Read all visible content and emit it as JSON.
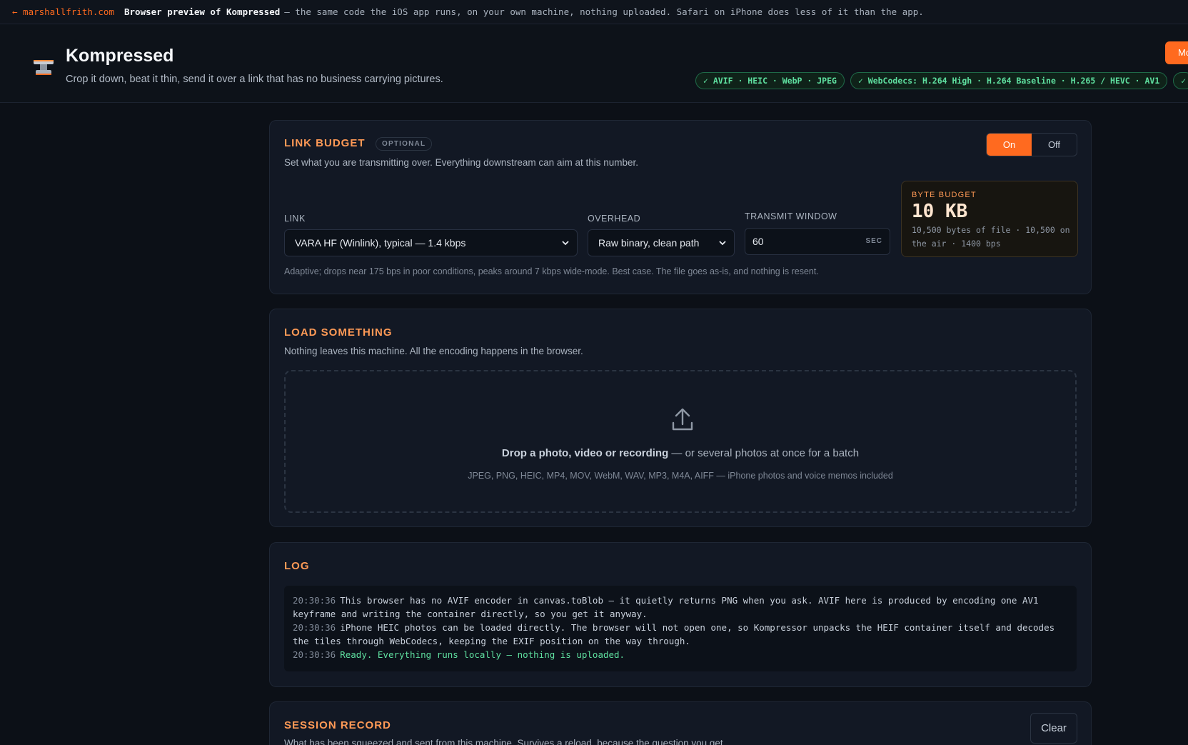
{
  "topbar": {
    "back_link": "← marshallfrith.com",
    "title": "Browser preview of Kompressed",
    "description": "— the same code the iOS app runs, on your own machine, nothing uploaded. Safari on iPhone does less of it than the app."
  },
  "header": {
    "app_name": "Kompressed",
    "tagline": "Crop it down, beat it thin, send it over a link that has no business carrying pictures.",
    "right_button": "Mo",
    "chips": [
      "✓ AVIF · HEIC · WebP · JPEG",
      "✓ WebCodecs: H.264 High · H.264 Baseline · H.265 / HEVC · AV1",
      "✓"
    ]
  },
  "link_budget": {
    "title": "LINK BUDGET",
    "badge": "OPTIONAL",
    "subtitle": "Set what you are transmitting over. Everything downstream can aim at this number.",
    "toggle": {
      "on": "On",
      "off": "Off",
      "active": "on"
    },
    "link_label": "LINK",
    "link_value": "VARA HF (Winlink), typical — 1.4 kbps",
    "overhead_label": "OVERHEAD",
    "overhead_value": "Raw binary, clean path",
    "window_label": "TRANSMIT WINDOW",
    "window_value": "60",
    "window_unit": "SEC",
    "byte_budget_label": "BYTE BUDGET",
    "byte_budget_value": "10 KB",
    "byte_budget_detail": "10,500 bytes of file · 10,500 on the air · 1400 bps",
    "hint": "Adaptive; drops near 175 bps in poor conditions, peaks around 7 kbps wide-mode. Best case. The file goes as-is, and nothing is resent."
  },
  "load": {
    "title": "LOAD SOMETHING",
    "subtitle": "Nothing leaves this machine. All the encoding happens in the browser.",
    "drop_strong": "Drop a photo, video or recording",
    "drop_rest": " — or several photos at once for a batch",
    "formats": "JPEG, PNG, HEIC, MP4, MOV, WebM, WAV, MP3, M4A, AIFF — iPhone photos and voice memos included"
  },
  "log": {
    "title": "LOG",
    "entries": [
      {
        "time": "20:30:36",
        "text": "This browser has no AVIF encoder in canvas.toBlob — it quietly returns PNG when you ask. AVIF here is produced by encoding one AV1 keyframe and writing the container directly, so you get it anyway."
      },
      {
        "time": "20:30:36",
        "text": "iPhone HEIC photos can be loaded directly. The browser will not open one, so Kompressor unpacks the HEIF container itself and decodes the tiles through WebCodecs, keeping the EXIF position on the way through."
      },
      {
        "time": "20:30:36",
        "text": "Ready. Everything runs locally — nothing is uploaded."
      }
    ]
  },
  "session": {
    "title": "SESSION RECORD",
    "subtitle": "What has been squeezed and sent from this machine. Survives a reload, because the question you get",
    "clear_button": "Clear"
  },
  "colors": {
    "accent": "#ff6a1f",
    "heading": "#ff9a56",
    "success": "#5fe0a0"
  },
  "icons": [
    "anvil-logo-icon",
    "chevron-down-icon",
    "upload-icon"
  ]
}
